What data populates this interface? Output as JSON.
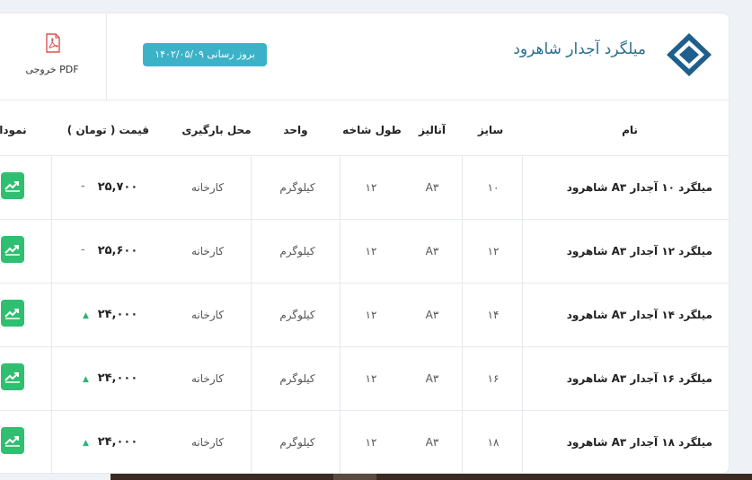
{
  "header": {
    "title": "میلگرد آجدار شاهرود",
    "update_badge": "بروز رسانی ۱۴۰۲/۰۵/۰۹",
    "pdf_label": "خروجی PDF",
    "logo_icon": "diamond-logo-icon",
    "pdf_icon": "pdf-file-icon"
  },
  "table": {
    "columns": {
      "name": "نام",
      "size": "سایز",
      "analysis": "آنالیز",
      "length": "طول شاخه",
      "unit": "واحد",
      "location": "محل بارگیری",
      "price": "قیمت ( تومان )",
      "chart": "نمودار"
    },
    "rows": [
      {
        "name": "میلگرد ۱۰ آجدار A۳ شاهرود",
        "size": "۱۰",
        "analysis": "A۳",
        "length": "۱۲",
        "unit": "کیلوگرم",
        "location": "کارخانه",
        "price": "۲۵,۷۰۰",
        "trend": "flat"
      },
      {
        "name": "میلگرد ۱۲ آجدار A۳ شاهرود",
        "size": "۱۲",
        "analysis": "A۳",
        "length": "۱۲",
        "unit": "کیلوگرم",
        "location": "کارخانه",
        "price": "۲۵,۶۰۰",
        "trend": "flat"
      },
      {
        "name": "میلگرد ۱۴ آجدار A۳ شاهرود",
        "size": "۱۴",
        "analysis": "A۳",
        "length": "۱۲",
        "unit": "کیلوگرم",
        "location": "کارخانه",
        "price": "۲۴,۰۰۰",
        "trend": "up"
      },
      {
        "name": "میلگرد ۱۶ آجدار A۳ شاهرود",
        "size": "۱۶",
        "analysis": "A۳",
        "length": "۱۲",
        "unit": "کیلوگرم",
        "location": "کارخانه",
        "price": "۲۴,۰۰۰",
        "trend": "up"
      },
      {
        "name": "میلگرد ۱۸ آجدار A۳ شاهرود",
        "size": "۱۸",
        "analysis": "A۳",
        "length": "۱۲",
        "unit": "کیلوگرم",
        "location": "کارخانه",
        "price": "۲۴,۰۰۰",
        "trend": "up"
      }
    ]
  },
  "colors": {
    "accent": "#3cb2c9",
    "title": "#2b6f8e",
    "logo": "#1f5f8b",
    "chart_button": "#2fbf71",
    "trend_up": "#2bb673"
  }
}
